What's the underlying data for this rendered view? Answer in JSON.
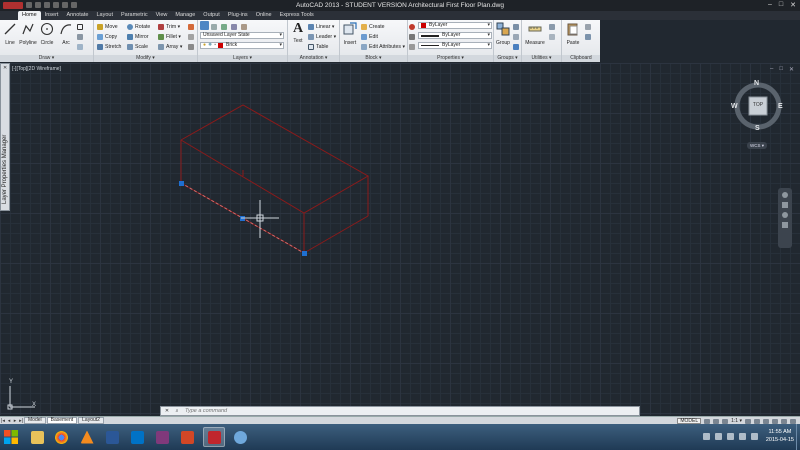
{
  "titlebar": {
    "title": "AutoCAD 2013 - STUDENT VERSION    Architectural First Floor Plan.dwg",
    "minimize": "–",
    "maximize": "□",
    "close": "✕"
  },
  "ribbon_tabs": [
    "Home",
    "Insert",
    "Annotate",
    "Layout",
    "Parametric",
    "View",
    "Manage",
    "Output",
    "Plug-ins",
    "Online",
    "Express Tools"
  ],
  "ribbon": {
    "draw": {
      "title": "Draw ▾",
      "line": "Line",
      "polyline": "Polyline",
      "circle": "Circle",
      "arc": "Arc"
    },
    "modify": {
      "title": "Modify ▾",
      "move": "Move",
      "rotate": "Rotate",
      "trim": "Trim ▾",
      "copy": "Copy",
      "mirror": "Mirror",
      "fillet": "Fillet ▾",
      "stretch": "Stretch",
      "scale": "Scale",
      "array": "Array ▾"
    },
    "layers": {
      "title": "Layers ▾",
      "layer_state": "Unsaved Layer State",
      "current_layer": "Brick",
      "layer_color": "#cc0000"
    },
    "annotation": {
      "title": "Annotation ▾",
      "text": "Text",
      "linear": "Linear ▾",
      "leader": "Leader ▾",
      "table": "Table"
    },
    "block": {
      "title": "Block ▾",
      "insert": "Insert",
      "create": "Create",
      "edit": "Edit",
      "edit_attributes": "Edit Attributes ▾"
    },
    "properties": {
      "title": "Properties ▾",
      "color": "ByLayer",
      "lineweight": "ByLayer",
      "linetype": "ByLayer"
    },
    "groups": {
      "title": "Groups ▾",
      "group": "Group"
    },
    "utilities": {
      "title": "Utilities ▾",
      "measure": "Measure"
    },
    "clipboard": {
      "title": "Clipboard",
      "paste": "Paste"
    }
  },
  "viewport": {
    "label": "[-][Top][2D Wireframe]",
    "doc_controls": [
      "–",
      "□",
      "✕"
    ]
  },
  "palette": {
    "label": "Layer Properties Manager",
    "close": "✕"
  },
  "viewcube": {
    "top": "TOP",
    "n": "N",
    "s": "S",
    "e": "E",
    "w": "W",
    "wcs": "WCS ▾"
  },
  "ucs": {
    "x": "X",
    "y": "Y"
  },
  "cmdline": {
    "placeholder": "Type a command",
    "close": "✕",
    "search": "⌕"
  },
  "layout_tabs": [
    "Model",
    "Basement",
    "Layout2"
  ],
  "layout_active": "Basement",
  "status": {
    "model": "MODEL",
    "scale": "1:1 ▾"
  },
  "taskbar": {
    "time": "11:55 AM",
    "date": "2015-04-15"
  },
  "colors": {
    "drawing_lines": "#8b1a1a",
    "grip": "#1f6fd1",
    "canvas_bg": "#212830"
  }
}
